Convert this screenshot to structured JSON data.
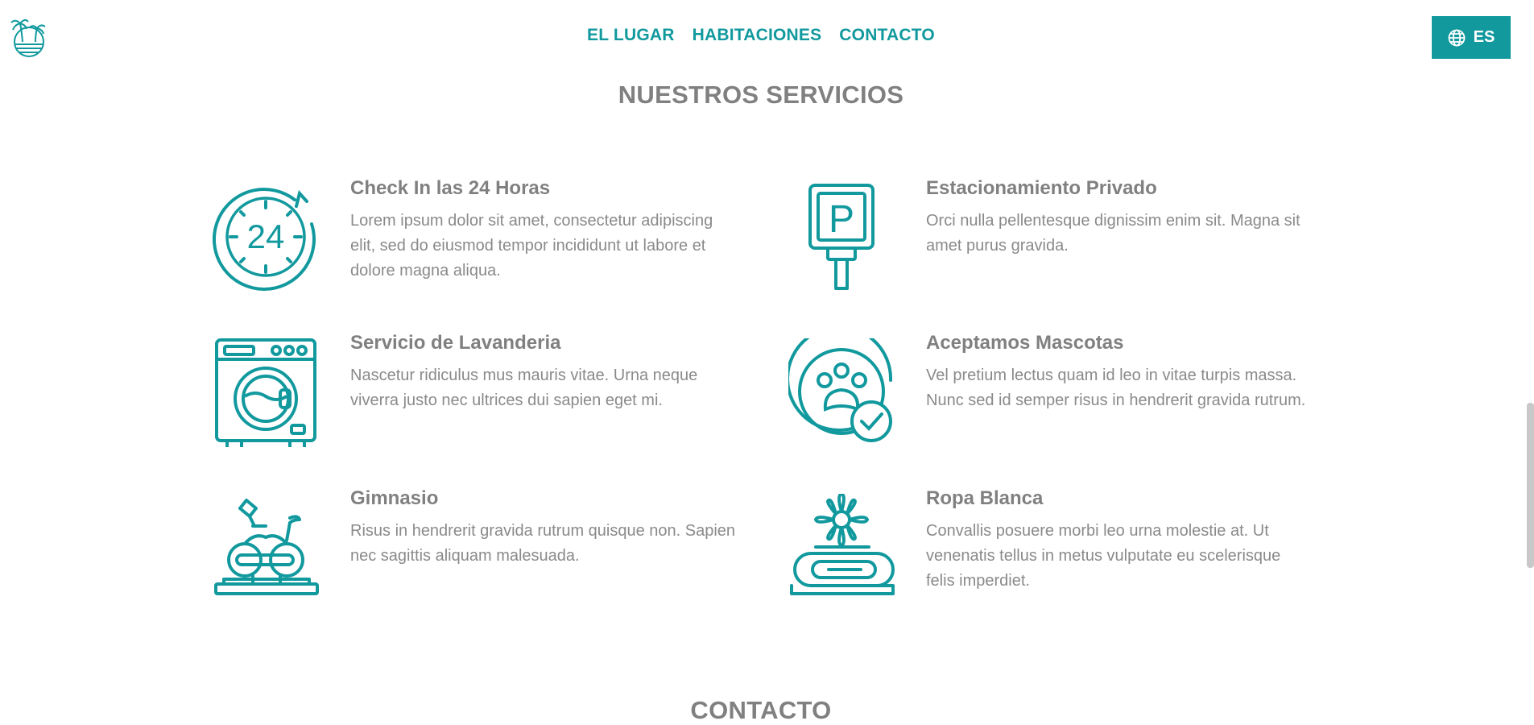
{
  "header": {
    "nav": [
      {
        "label": "EL LUGAR"
      },
      {
        "label": "HABITACIONES"
      },
      {
        "label": "CONTACTO"
      }
    ],
    "language": {
      "label": "ES",
      "icon": "globe-icon"
    }
  },
  "services": {
    "title": "NUESTROS SERVICIOS",
    "items": [
      {
        "title": "Check In las 24 Horas",
        "text": "Lorem ipsum dolor sit amet, consectetur adipiscing elit, sed do eiusmod tempor incididunt ut labore et dolore magna aliqua.",
        "icon": "clock-24-icon"
      },
      {
        "title": "Estacionamiento Privado",
        "text": "Orci nulla pellentesque dignissim enim sit. Magna sit amet purus gravida.",
        "icon": "parking-sign-icon"
      },
      {
        "title": "Servicio de Lavanderia",
        "text": "Nascetur ridiculus mus mauris vitae. Urna neque viverra justo nec ultrices dui sapien eget mi.",
        "icon": "washing-machine-icon"
      },
      {
        "title": "Aceptamos Mascotas",
        "text": "Vel pretium lectus quam id leo in vitae turpis massa. Nunc sed id semper risus in hendrerit gravida rutrum.",
        "icon": "pet-paw-icon"
      },
      {
        "title": "Gimnasio",
        "text": "Risus in hendrerit gravida rutrum quisque non. Sapien nec sagittis aliquam malesuada.",
        "icon": "exercise-bike-icon"
      },
      {
        "title": "Ropa Blanca",
        "text": "Convallis posuere morbi leo urna molestie at. Ut venenatis tellus in metus vulputate eu scelerisque felis imperdiet.",
        "icon": "folded-towel-icon"
      }
    ]
  },
  "contact": {
    "title": "CONTACTO"
  },
  "colors": {
    "accent": "#11999e",
    "text": "#808080",
    "background": "#ffffff"
  }
}
